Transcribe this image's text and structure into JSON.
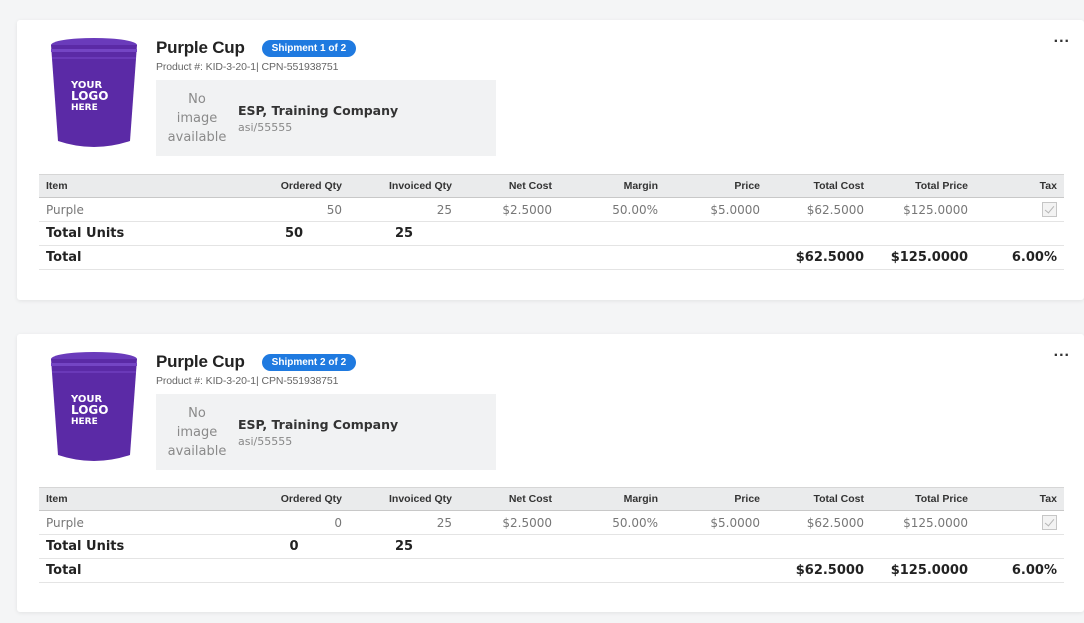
{
  "shipments": [
    {
      "product_name": "Purple Cup",
      "badge": "Shipment 1 of 2",
      "product_number": "Product #: KID-3-20-1| CPN-551938751",
      "no_image": [
        "No",
        "image",
        "available"
      ],
      "supplier_name": "ESP, Training Company",
      "supplier_asi": "asi/55555",
      "more": "...",
      "logo_text": [
        "YOUR",
        "LOGO",
        "HERE"
      ],
      "columns": [
        "Item",
        "Ordered Qty",
        "Invoiced Qty",
        "Net Cost",
        "Margin",
        "Price",
        "Total Cost",
        "Total Price",
        "Tax"
      ],
      "row": {
        "item": "Purple",
        "ordered_qty": "50",
        "invoiced_qty": "25",
        "net_cost": "$2.5000",
        "margin": "50.00%",
        "price": "$5.0000",
        "total_cost": "$62.5000",
        "total_price": "$125.0000",
        "tax_checked": true
      },
      "total_units": {
        "label": "Total Units",
        "ordered": "50",
        "invoiced": "25"
      },
      "total": {
        "label": "Total",
        "total_cost": "$62.5000",
        "total_price": "$125.0000",
        "tax": "6.00%"
      }
    },
    {
      "product_name": "Purple Cup",
      "badge": "Shipment 2 of 2",
      "product_number": "Product #: KID-3-20-1| CPN-551938751",
      "no_image": [
        "No",
        "image",
        "available"
      ],
      "supplier_name": "ESP, Training Company",
      "supplier_asi": "asi/55555",
      "more": "...",
      "logo_text": [
        "YOUR",
        "LOGO",
        "HERE"
      ],
      "columns": [
        "Item",
        "Ordered Qty",
        "Invoiced Qty",
        "Net Cost",
        "Margin",
        "Price",
        "Total Cost",
        "Total Price",
        "Tax"
      ],
      "row": {
        "item": "Purple",
        "ordered_qty": "0",
        "invoiced_qty": "25",
        "net_cost": "$2.5000",
        "margin": "50.00%",
        "price": "$5.0000",
        "total_cost": "$62.5000",
        "total_price": "$125.0000",
        "tax_checked": true
      },
      "total_units": {
        "label": "Total Units",
        "ordered": "0",
        "invoiced": "25"
      },
      "total": {
        "label": "Total",
        "total_cost": "$62.5000",
        "total_price": "$125.0000",
        "tax": "6.00%"
      }
    }
  ],
  "colors": {
    "badge": "#1f7ae0",
    "cup": "#5b2aa6",
    "header_bg": "#eaebec"
  }
}
